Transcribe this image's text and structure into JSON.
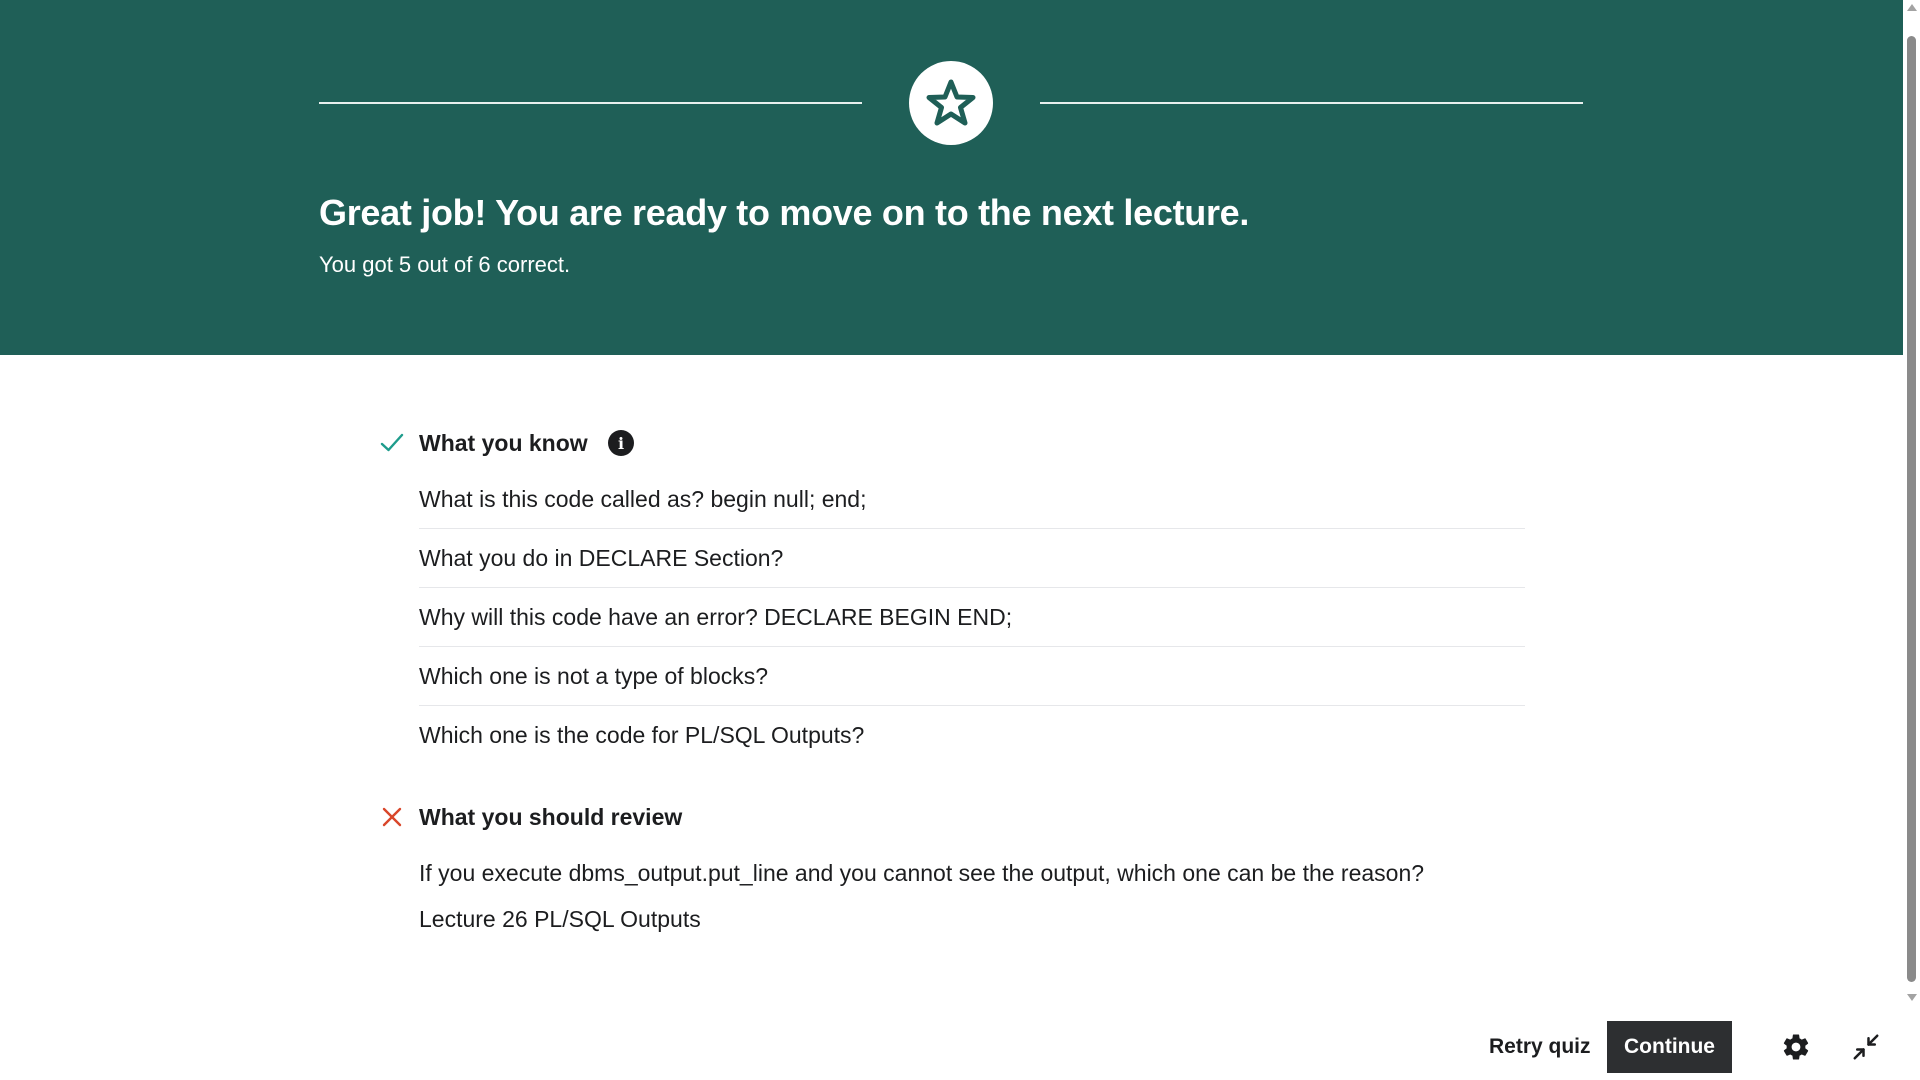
{
  "hero": {
    "title": "Great job! You are ready to move on to the next lecture.",
    "subtitle": "You got 5 out of 6 correct.",
    "badge_icon": "star-icon",
    "background_color": "#1f5f57"
  },
  "know_section": {
    "title": "What you know",
    "status_icon": "check-icon",
    "status_color": "#1e9c8c",
    "info_icon": "info-icon",
    "items": [
      "What is this code called as? begin null; end;",
      "What you do in DECLARE Section?",
      "Why will this code have an error? DECLARE BEGIN END;",
      "Which one is not a type of blocks?",
      "Which one is the code for PL/SQL Outputs?"
    ]
  },
  "review_section": {
    "title": "What you should review",
    "status_icon": "x-icon",
    "status_color": "#d9462a",
    "items": [
      {
        "question": "If you execute dbms_output.put_line and you cannot see the output, which one can be the reason?",
        "reference": "Lecture 26 PL/SQL Outputs"
      }
    ]
  },
  "footer": {
    "retry_label": "Retry quiz",
    "continue_label": "Continue",
    "settings_icon": "gear-icon",
    "collapse_icon": "collapse-icon"
  }
}
